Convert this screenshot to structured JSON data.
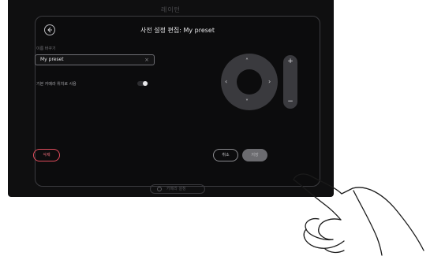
{
  "screen": {
    "top_hint": "레이턴",
    "title": "사전 설정 편집: My preset",
    "name_field": {
      "label": "이름 바꾸기",
      "value": "My preset",
      "clear_icon": "x-icon"
    },
    "toggle": {
      "label": "기본 카메라 위치로 사용",
      "state": "on"
    },
    "camera": {
      "up": "˄",
      "down": "˅",
      "left": "‹",
      "right": "›",
      "zoom_in": "+",
      "zoom_out": "−"
    },
    "buttons": {
      "delete": "삭제",
      "cancel": "취소",
      "save": "저장"
    },
    "bottom_pill_label": "카메라 설정"
  },
  "colors": {
    "screen_bg": "#0f0f10",
    "panel_border": "#3c3c40",
    "delete_accent": "#e04c5c",
    "save_bg": "#6b6b6f"
  }
}
